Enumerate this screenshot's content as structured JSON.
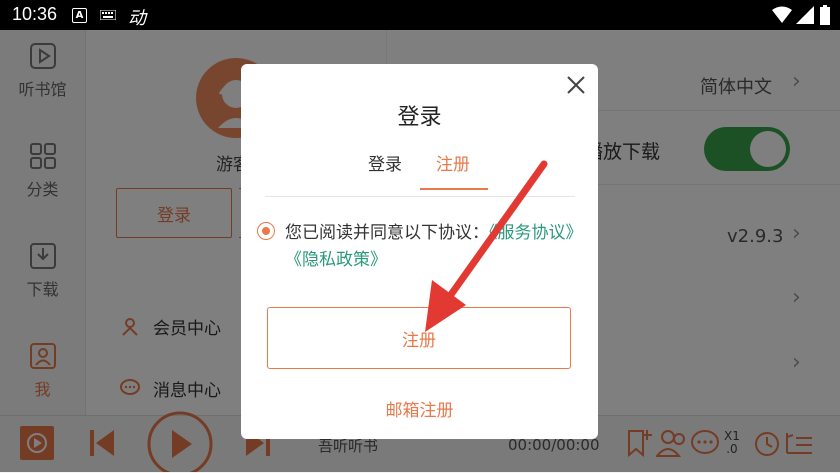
{
  "status_bar": {
    "time": "10:36",
    "a_badge": "A",
    "ime": "动"
  },
  "sidebar": {
    "items": [
      {
        "label": "听书馆",
        "icon": "play-square-icon"
      },
      {
        "label": "分类",
        "icon": "grid-icon"
      },
      {
        "label": "下载",
        "icon": "download-icon"
      },
      {
        "label": "我",
        "icon": "person-icon",
        "active": true
      }
    ]
  },
  "profile": {
    "guest_label": "游客",
    "login_label": "登录"
  },
  "menu": [
    {
      "label": "会员中心",
      "icon": "vip-icon"
    },
    {
      "label": "消息中心",
      "icon": "message-icon"
    }
  ],
  "settings": {
    "language": "简体中文",
    "download_label": "播放下载",
    "download_on": true,
    "version": "v2.9.3"
  },
  "player": {
    "title": "吾听听书",
    "time": "00:00/00:00",
    "speed_top": "X1",
    "speed_bottom": ".0"
  },
  "modal": {
    "title": "登录",
    "tabs": [
      {
        "label": "登录",
        "active": false
      },
      {
        "label": "注册",
        "active": true
      }
    ],
    "agreement_prefix": "您已阅读并同意以下协议：",
    "service_link": "《服务协议》",
    "privacy_link": "《隐私政策》",
    "agreement_checked": true,
    "register_button": "注册",
    "email_register": "邮箱注册"
  },
  "colors": {
    "accent": "#e8794a",
    "link": "#2a9a7a",
    "toggle": "#36a24b"
  }
}
